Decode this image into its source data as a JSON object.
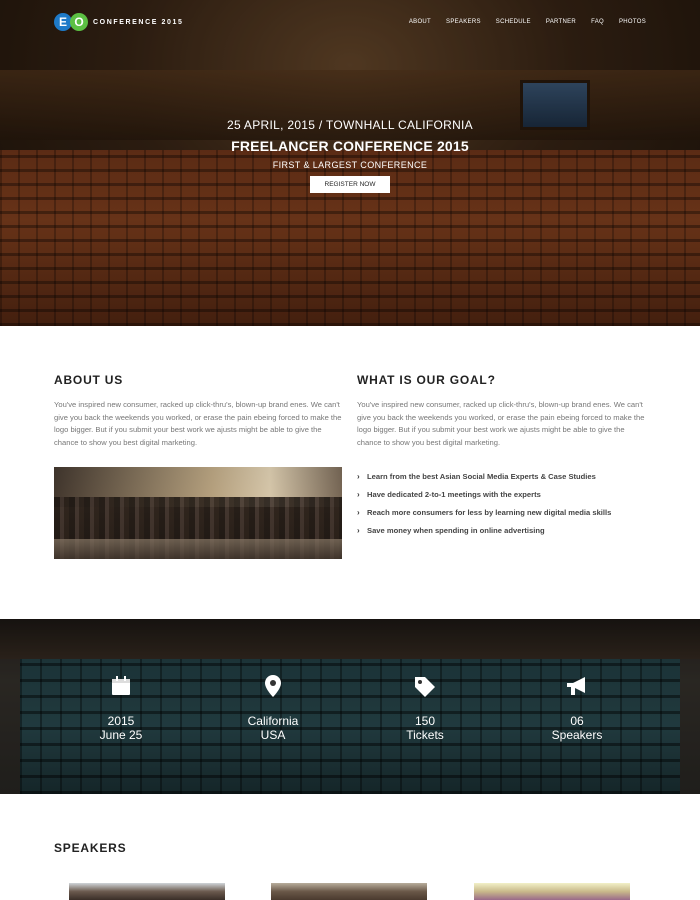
{
  "brand": {
    "logo_letters": [
      "E",
      "O"
    ],
    "name": "CONFERENCE 2015",
    "colors": {
      "blue": "#1e7ac8",
      "green": "#5cc043"
    }
  },
  "nav": {
    "items": [
      "ABOUT",
      "SPEAKERS",
      "SCHEDULE",
      "PARTNER",
      "FAQ",
      "PHOTOS"
    ]
  },
  "hero": {
    "date_location": "25 APRIL, 2015 / TOWNHALL CALIFORNIA",
    "title": "FREELANCER CONFERENCE 2015",
    "subtitle": "FIRST & LARGEST CONFERENCE",
    "cta": "REGISTER NOW"
  },
  "about": {
    "title": "ABOUT US",
    "text": "You've inspired new consumer, racked up click-thru's, blown-up brand enes. We can't give you back the weekends you worked, or erase the pain ebeing forced to make the logo bigger. But if you submit your best work we ajusts might be able to give the chance to show you best digital marketing."
  },
  "goal": {
    "title": "WHAT IS OUR GOAL?",
    "text": "You've inspired new consumer, racked up click-thru's, blown-up brand enes. We can't give you back the weekends you worked, or erase the pain ebeing forced to make the logo bigger. But if you submit your best work we ajusts might be able to give the chance to show you best digital marketing.",
    "points": [
      "Learn from the best Asian Social Media Experts & Case Studies",
      "Have dedicated 2-to-1 meetings with the experts",
      "Reach more consumers for less by learning new digital media skills",
      "Save money when spending in online advertising"
    ]
  },
  "stats": [
    {
      "icon": "calendar-icon",
      "line1": "2015",
      "line2": "June 25"
    },
    {
      "icon": "map-pin-icon",
      "line1": "California",
      "line2": "USA"
    },
    {
      "icon": "tag-icon",
      "line1": "150",
      "line2": "Tickets"
    },
    {
      "icon": "megaphone-icon",
      "line1": "06",
      "line2": "Speakers"
    }
  ],
  "speakers": {
    "title": "SPEAKERS"
  }
}
